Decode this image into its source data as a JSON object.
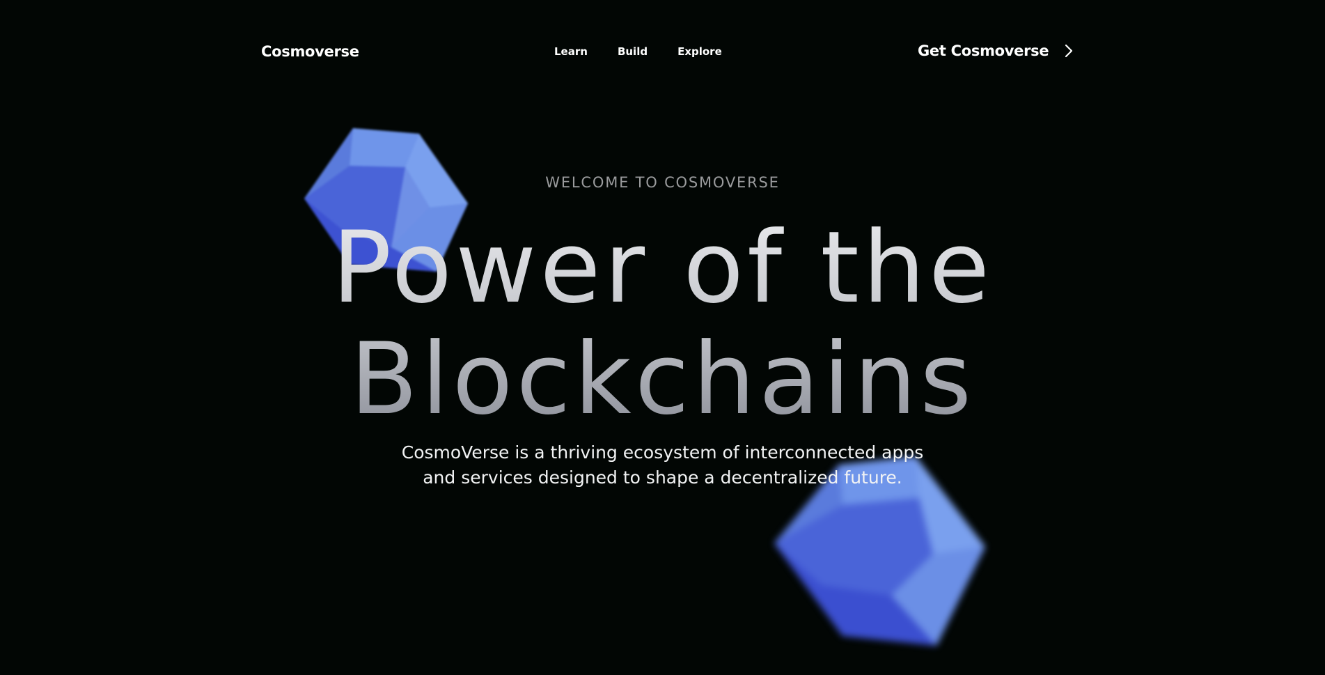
{
  "header": {
    "brand": "Cosmoverse",
    "nav": [
      {
        "label": "Learn"
      },
      {
        "label": "Build"
      },
      {
        "label": "Explore"
      }
    ],
    "cta_label": "Get Cosmoverse",
    "cta_icon": "chevron-right-icon"
  },
  "hero": {
    "eyebrow": "WELCOME TO COSMOVERSE",
    "headline_line1": "Power of the",
    "headline_line2": "Blockchains",
    "subtitle_line1": "CosmoVerse is a thriving ecosystem of interconnected apps",
    "subtitle_line2": "and services designed to shape a decentralized future."
  },
  "decor": {
    "gem_icon": "blue-polyhedron-graphic",
    "gem_color_light": "#6b8fe6",
    "gem_color_dark": "#2f3fd0"
  },
  "colors": {
    "background": "#020604",
    "text_primary": "#ffffff",
    "eyebrow": "#9a9b9d"
  }
}
